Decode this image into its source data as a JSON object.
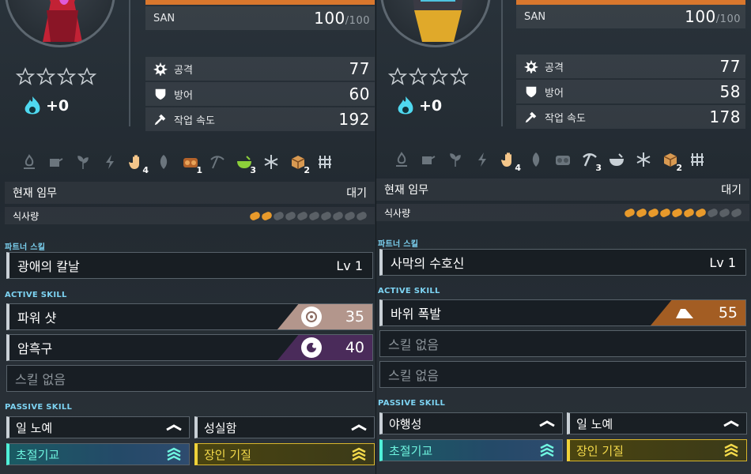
{
  "left": {
    "san_label": "SAN",
    "san_value": "100",
    "san_max": "/100",
    "stars": 4,
    "soul_bonus": "+0",
    "stats": [
      {
        "icon": "attack-icon",
        "label": "공격",
        "value": "77"
      },
      {
        "icon": "defense-icon",
        "label": "방어",
        "value": "60"
      },
      {
        "icon": "work-speed-icon",
        "label": "작업 속도",
        "value": "192"
      }
    ],
    "work_levels": {
      "handiwork": "4",
      "lumbering": "1",
      "mining": "",
      "medicine": "3",
      "transporting": "2"
    },
    "task_label": "현재 임무",
    "task_value": "대기",
    "food_label": "식사량",
    "food_filled": 2,
    "food_total": 10,
    "partner_heading": "파트너 스킬",
    "partner_skill": "광애의 칼날",
    "partner_level": "Lv  1",
    "active_heading": "ACTIVE SKILL",
    "active": [
      {
        "name": "파워 샷",
        "cost": "35",
        "element": "neutral",
        "color": "#b3968c"
      },
      {
        "name": "암흑구",
        "cost": "40",
        "element": "dark",
        "color": "#4a2b5a"
      },
      {
        "name": "스킬 없음",
        "cost": "",
        "element": ""
      }
    ],
    "passive_heading": "PASSIVE SKILL",
    "passive": [
      {
        "name": "일 노예",
        "style": "plain"
      },
      {
        "name": "성실함",
        "style": "plain"
      },
      {
        "name": "초절기교",
        "style": "cyan"
      },
      {
        "name": "장인 기질",
        "style": "gold"
      }
    ]
  },
  "right": {
    "san_label": "SAN",
    "san_value": "100",
    "san_max": "/100",
    "stars": 4,
    "soul_bonus": "+0",
    "stats": [
      {
        "icon": "attack-icon",
        "label": "공격",
        "value": "77"
      },
      {
        "icon": "defense-icon",
        "label": "방어",
        "value": "58"
      },
      {
        "icon": "work-speed-icon",
        "label": "작업 속도",
        "value": "178"
      }
    ],
    "work_levels": {
      "handiwork": "4",
      "mining": "3",
      "transporting": "2"
    },
    "task_label": "현재 임무",
    "task_value": "대기",
    "food_label": "식사량",
    "food_filled": 7,
    "food_total": 10,
    "partner_heading": "파트너 스킬",
    "partner_skill": "사막의 수호신",
    "partner_level": "Lv  1",
    "active_heading": "ACTIVE SKILL",
    "active": [
      {
        "name": "바위 폭발",
        "cost": "55",
        "element": "ground",
        "color": "#a35d23"
      },
      {
        "name": "스킬 없음",
        "cost": "",
        "element": ""
      },
      {
        "name": "스킬 없음",
        "cost": "",
        "element": ""
      }
    ],
    "passive_heading": "PASSIVE SKILL",
    "passive": [
      {
        "name": "야행성",
        "style": "plain"
      },
      {
        "name": "일 노예",
        "style": "plain"
      },
      {
        "name": "초절기교",
        "style": "cyan"
      },
      {
        "name": "장인 기질",
        "style": "gold"
      }
    ]
  }
}
